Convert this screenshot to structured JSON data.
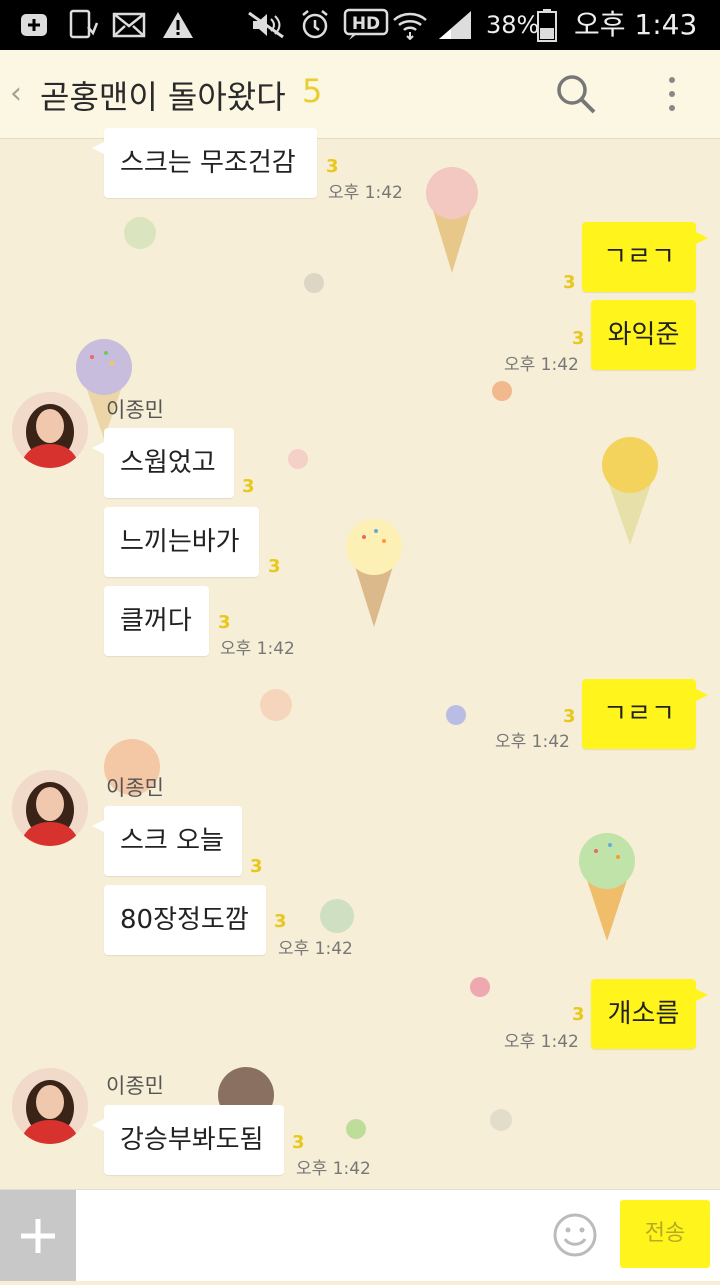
{
  "status_bar": {
    "battery": "38%",
    "clock": "오후 1:43",
    "icons": [
      "plus-icon",
      "download-icon",
      "mail-icon",
      "warning-icon",
      "mute-icon",
      "alarm-icon",
      "hd-icon",
      "wifi-icon",
      "signal-icon",
      "battery-icon"
    ]
  },
  "header": {
    "back": "‹",
    "title": "곧홍맨이 돌아왔다",
    "member_count": "5"
  },
  "messages": [
    {
      "side": "them",
      "text": "스크는 무조건감",
      "unread": "3",
      "time": "오후 1:42"
    },
    {
      "side": "me",
      "text": "ㄱㄹㄱ",
      "unread": "3",
      "time": ""
    },
    {
      "side": "me",
      "text": "와익준",
      "unread": "3",
      "time": "오후 1:42"
    },
    {
      "side": "them",
      "sender": "이종민",
      "text": "스웝었고",
      "unread": "3",
      "time": ""
    },
    {
      "side": "them",
      "text": "느끼는바가",
      "unread": "3",
      "time": ""
    },
    {
      "side": "them",
      "text": "클꺼다",
      "unread": "3",
      "time": "오후 1:42"
    },
    {
      "side": "me",
      "text": "ㄱㄹㄱ",
      "unread": "3",
      "time": "오후 1:42"
    },
    {
      "side": "them",
      "sender": "이종민",
      "text": "스크 오늘",
      "unread": "3",
      "time": ""
    },
    {
      "side": "them",
      "text": "80장정도깜",
      "unread": "3",
      "time": "오후 1:42"
    },
    {
      "side": "me",
      "text": "개소름",
      "unread": "3",
      "time": "오후 1:42"
    },
    {
      "side": "them",
      "sender": "이종민",
      "text": "강승부봐도됨",
      "unread": "3",
      "time": "오후 1:42"
    }
  ],
  "input": {
    "plus": "+",
    "placeholder": "",
    "send_label": "전송"
  },
  "colors": {
    "background": "#f6eed6",
    "my_bubble": "#fff51d",
    "their_bubble": "#ffffff",
    "unread": "#e8c81c"
  }
}
